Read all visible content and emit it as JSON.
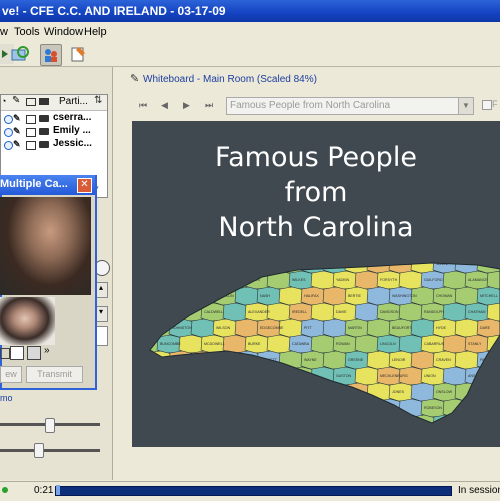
{
  "window": {
    "title": "ve! - CFE C.C. AND IRELAND - 03-17-09"
  },
  "menu": {
    "items": [
      "w",
      "Tools",
      "Window",
      "Help"
    ]
  },
  "participants": {
    "header": "Parti...",
    "rows": [
      {
        "name": "cserra..."
      },
      {
        "name": "Emily ..."
      },
      {
        "name": "Jessic..."
      }
    ]
  },
  "video": {
    "title": "Multiple Ca...",
    "buttons": [
      "ew",
      "Transmit"
    ]
  },
  "audio": {
    "label": "mo"
  },
  "whiteboard": {
    "title": "Whiteboard - Main Room (Scaled 84%)",
    "page_select": "Famous People from North Carolina",
    "slide_lines": [
      "Famous People",
      "from",
      "North Carolina"
    ],
    "map_labels": [
      "ASHE",
      "SURRY",
      "STOKES",
      "ROCKINGHAM",
      "CASWELL",
      "PERSON",
      "GRANVILLE",
      "VANCE",
      "WARREN",
      "NORTHAMPTON",
      "HERTFORD",
      "GATES",
      "WILKES",
      "YADKIN",
      "FORSYTH",
      "GUILFORD",
      "ALAMANCE",
      "ORANGE",
      "DURHAM",
      "FRANKLIN",
      "NASH",
      "HALIFAX",
      "BERTIE",
      "WASHINGTON",
      "CHOWAN",
      "MITCHELL",
      "AVERY",
      "CALDWELL",
      "ALEXANDER",
      "IREDELL",
      "DAVIE",
      "DAVIDSON",
      "RANDOLPH",
      "CHATHAM",
      "WAKE",
      "JOHNSTON",
      "WILSON",
      "EDGECOMBE",
      "PITT",
      "MARTIN",
      "BEAUFORT",
      "HYDE",
      "DARE",
      "BUNCOMBE",
      "MCDOWELL",
      "BURKE",
      "CATAWBA",
      "ROWAN",
      "LINCOLN",
      "CABARRUS",
      "STANLY",
      "MONTGOMERY",
      "MOORE",
      "LEE",
      "HARNETT",
      "WAYNE",
      "GREENE",
      "LENOIR",
      "CRAVEN",
      "PAMLICO",
      "HAYWOOD",
      "HENDERSON",
      "RUTHERFORD",
      "CLEVELAND",
      "GASTON",
      "MECKLENBURG",
      "UNION",
      "ANSON",
      "RICHMOND",
      "SCOTLAND",
      "HOKE",
      "CUMBERLAND",
      "SAMPSON",
      "DUPLIN",
      "JONES",
      "ONSLOW",
      "CARTERET",
      "CHEROKEE",
      "CLAY",
      "MACON",
      "JACKSON",
      "TRANSYLVANIA",
      "POLK",
      "ROBESON",
      "BLADEN",
      "PENDER",
      "COLUMBUS",
      "BRUNSWICK",
      "NEW HANOVER",
      "GRAHAM",
      "SWAIN"
    ]
  },
  "status": {
    "time": "0:21",
    "text": "In session"
  },
  "colors": {
    "slide_bg": "#404950",
    "county_yellow": "#e8e35f",
    "county_green": "#a6cc72",
    "county_blue": "#8fb9dc",
    "county_orange": "#e9b76a",
    "county_teal": "#71c0b6"
  }
}
